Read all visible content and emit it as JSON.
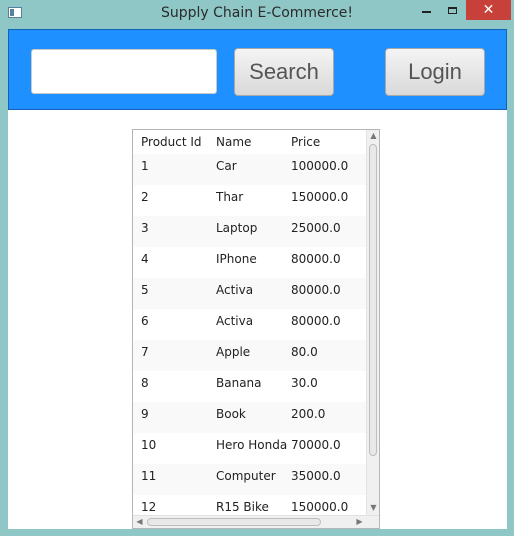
{
  "window": {
    "title": "Supply Chain E-Commerce!",
    "minimize_icon": "minimize-icon",
    "maximize_icon": "maximize-icon",
    "close_icon": "close-icon",
    "close_glyph": "✕",
    "app_icon": "window-app-icon"
  },
  "toolbar": {
    "search_value": "",
    "search_label": "Search",
    "login_label": "Login",
    "background_color": "#1e90ff"
  },
  "table": {
    "columns": [
      "Product Id",
      "Name",
      "Price"
    ],
    "rows": [
      [
        "1",
        "Car",
        "100000.0"
      ],
      [
        "2",
        "Thar",
        "150000.0"
      ],
      [
        "3",
        "Laptop",
        "25000.0"
      ],
      [
        "4",
        "IPhone",
        "80000.0"
      ],
      [
        "5",
        "Activa",
        "80000.0"
      ],
      [
        "6",
        "Activa",
        "80000.0"
      ],
      [
        "7",
        "Apple",
        "80.0"
      ],
      [
        "8",
        "Banana",
        "30.0"
      ],
      [
        "9",
        "Book",
        "200.0"
      ],
      [
        "10",
        "Hero Honda",
        "70000.0"
      ],
      [
        "11",
        "Computer",
        "35000.0"
      ],
      [
        "12",
        "R15 Bike",
        "150000.0"
      ]
    ],
    "scroll_arrows": {
      "up": "▲",
      "down": "▼",
      "left": "◀",
      "right": "▶"
    }
  }
}
